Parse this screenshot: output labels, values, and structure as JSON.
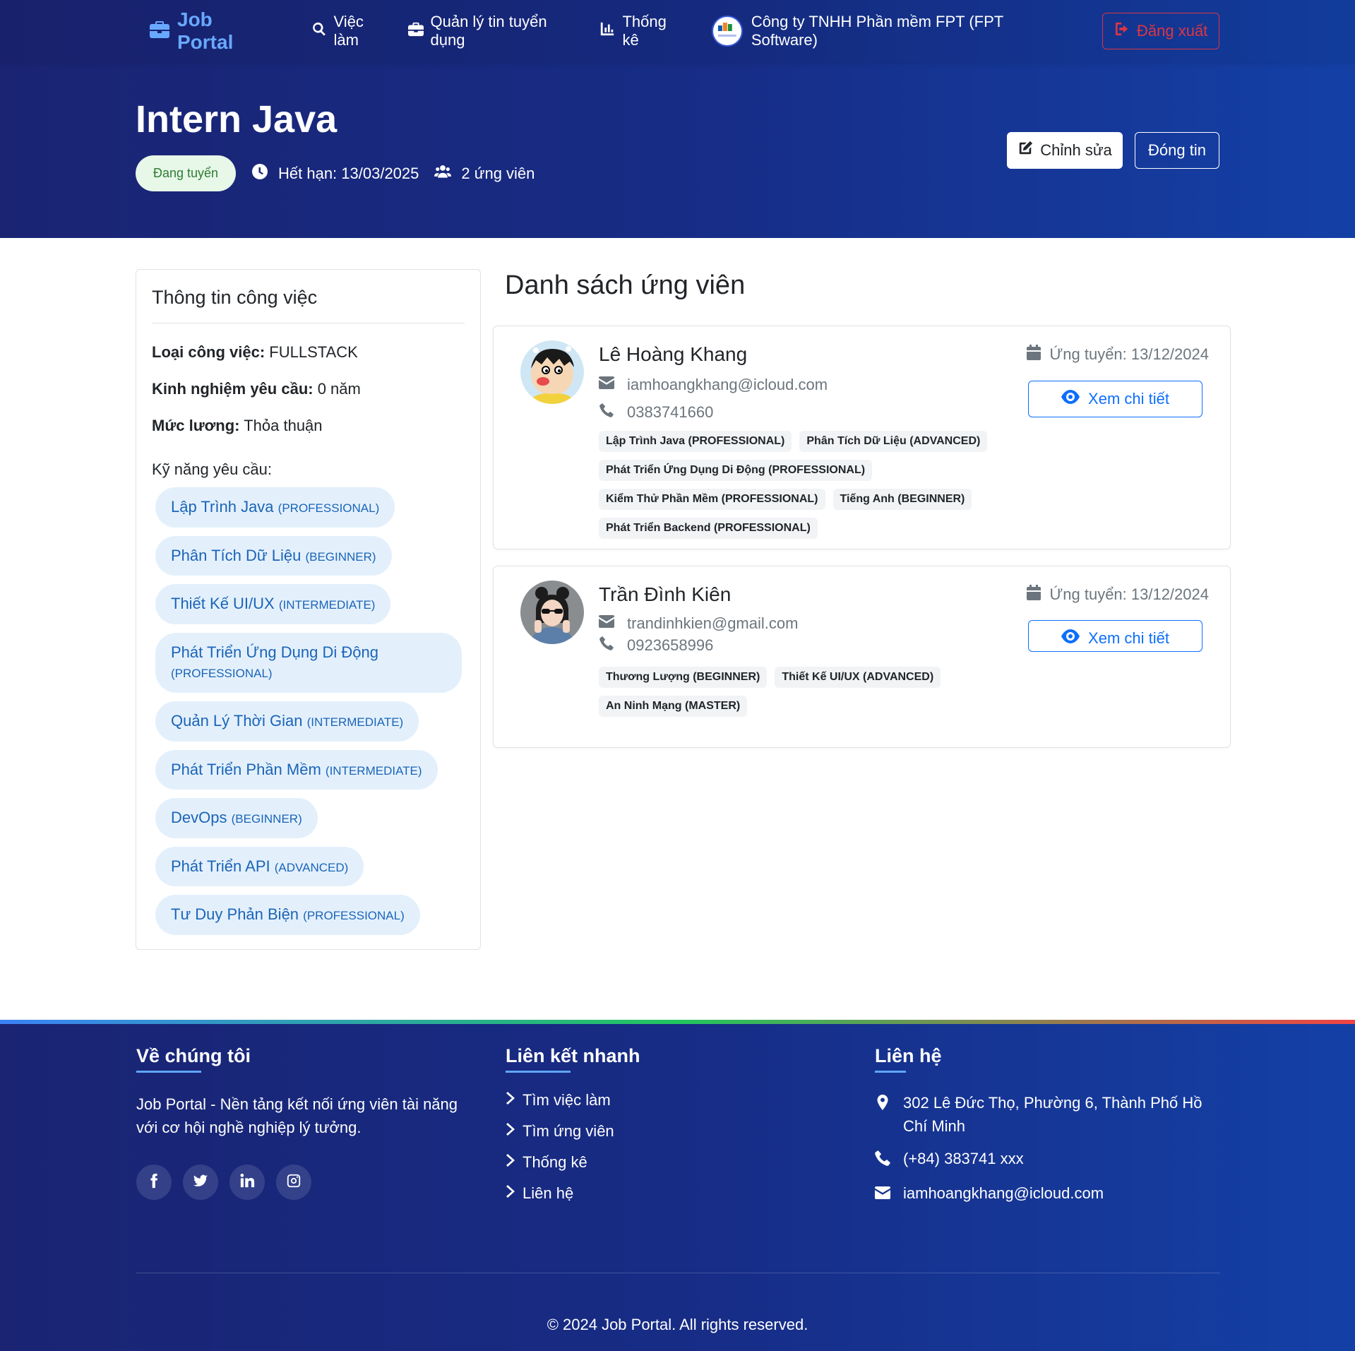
{
  "navbar": {
    "brand": "Job Portal",
    "links": [
      "Việc làm",
      "Quản lý tin tuyển dụng",
      "Thống kê"
    ],
    "company": "Công ty TNHH Phần mềm FPT (FPT Software)",
    "logout": "Đăng xuất"
  },
  "job": {
    "title": "Intern Java",
    "status": "Đang tuyển",
    "deadline": "Hết hạn: 13/03/2025",
    "applicants": "2 ứng viên",
    "edit_label": "Chỉnh sửa",
    "close_label": "Đóng tin"
  },
  "info": {
    "heading": "Thông tin công việc",
    "type_label": "Loại công việc:",
    "type_value": " FULLSTACK",
    "exp_label": "Kinh nghiệm yêu cầu:",
    "exp_value": " 0 năm",
    "salary_label": "Mức lương:",
    "salary_value": " Thỏa thuận",
    "skills_label": "Kỹ năng yêu cầu:",
    "skills": [
      {
        "name": "Lập Trình Java",
        "level": "(PROFESSIONAL)"
      },
      {
        "name": "Phân Tích Dữ Liệu",
        "level": "(BEGINNER)"
      },
      {
        "name": "Thiết Kế UI/UX",
        "level": "(INTERMEDIATE)"
      },
      {
        "name": "Phát Triển Ứng Dụng Di Động",
        "level": "(PROFESSIONAL)"
      },
      {
        "name": "Quản Lý Thời Gian",
        "level": "(INTERMEDIATE)"
      },
      {
        "name": "Phát Triển Phần Mềm",
        "level": "(INTERMEDIATE)"
      },
      {
        "name": "DevOps",
        "level": "(BEGINNER)"
      },
      {
        "name": "Phát Triển API",
        "level": "(ADVANCED)"
      },
      {
        "name": "Tư Duy Phản Biện",
        "level": "(PROFESSIONAL)"
      }
    ]
  },
  "candidates": {
    "heading": "Danh sách ứng viên",
    "view_label": "Xem chi tiết",
    "items": [
      {
        "name": "Lê Hoàng Khang",
        "email": "iamhoangkhang@icloud.com",
        "phone": "0383741660",
        "applied": "Ứng tuyển: 13/12/2024",
        "tags": [
          "Lập Trình Java (PROFESSIONAL)",
          "Phân Tích Dữ Liệu (ADVANCED)",
          "Phát Triển Ứng Dụng Di Động (PROFESSIONAL)",
          "Kiểm Thử Phần Mềm (PROFESSIONAL)",
          "Tiếng Anh (BEGINNER)",
          "Phát Triển Backend (PROFESSIONAL)"
        ]
      },
      {
        "name": "Trần Đình Kiên",
        "email": "trandinhkien@gmail.com",
        "phone": "0923658996",
        "applied": "Ứng tuyển: 13/12/2024",
        "tags": [
          "Thương Lượng (BEGINNER)",
          "Thiết Kế UI/UX (ADVANCED)",
          "An Ninh Mạng (MASTER)"
        ]
      }
    ]
  },
  "footer": {
    "about_title": "Về chúng tôi",
    "about_text": "Job Portal - Nền tảng kết nối ứng viên tài năng với cơ hội nghề nghiệp lý tưởng.",
    "links_title": "Liên kết nhanh",
    "links": [
      "Tìm việc làm",
      "Tìm ứng viên",
      "Thống kê",
      "Liên hệ"
    ],
    "contact_title": "Liên hệ",
    "address": "302 Lê Đức Thọ, Phường 6, Thành Phố Hồ Chí Minh",
    "phone": "(+84) 383741 xxx",
    "email": "iamhoangkhang@icloud.com",
    "copyright": "© 2024 Job Portal. All rights reserved."
  },
  "icons": {
    "brand": "briefcase-icon",
    "jobs": "search-icon",
    "manage": "briefcase-icon",
    "stats": "chart-icon",
    "logout": "sign-out-icon",
    "deadline": "clock-icon",
    "applicants": "users-icon",
    "edit": "edit-icon",
    "email": "envelope-icon",
    "phone": "phone-icon",
    "calendar": "calendar-icon",
    "view": "eye-icon"
  },
  "colors": {
    "header_start": "#1a2473",
    "header_end": "#1440a6",
    "brand": "#69a8ff",
    "danger": "#dc3545",
    "primary": "#0d6efd",
    "status_bg": "#e7f7e8",
    "status_text": "#2e7d32",
    "skill_bg": "#e3f0fc",
    "skill_text": "#1b64b8"
  }
}
